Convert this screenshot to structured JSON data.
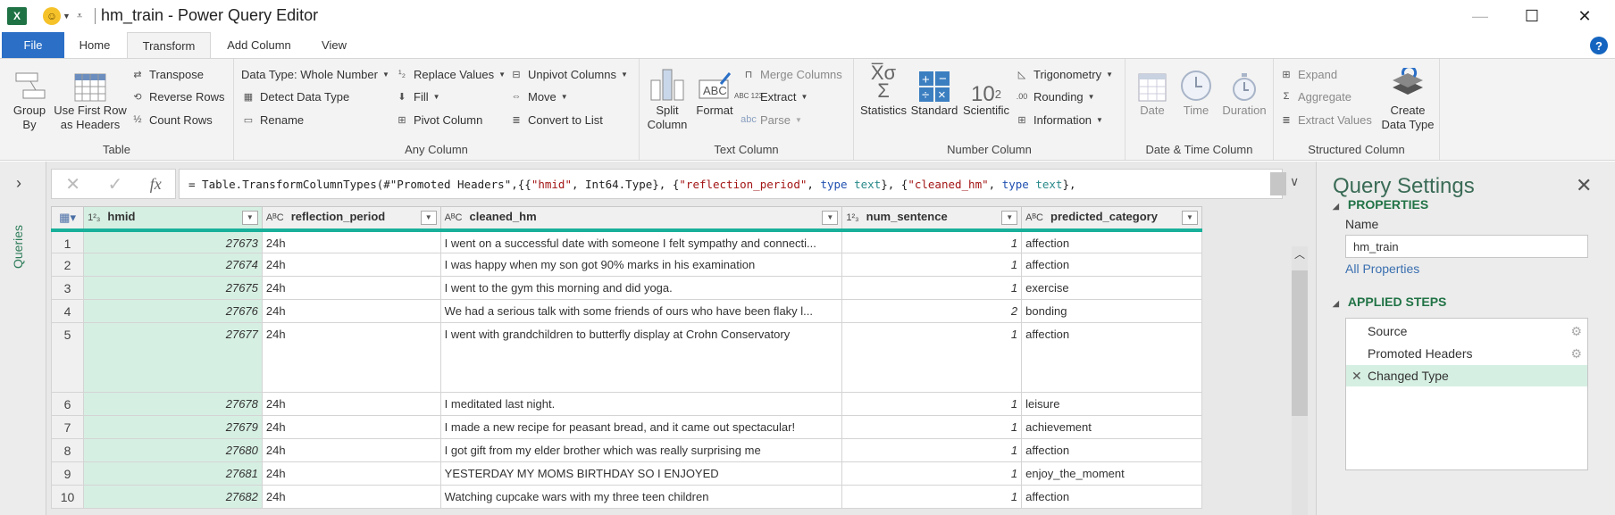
{
  "window": {
    "title": "hm_train - Power Query Editor",
    "app_icon": "excel-icon",
    "minimize": "—",
    "maximize": "☐",
    "close": "✕"
  },
  "tabs": [
    {
      "label": "File"
    },
    {
      "label": "Home"
    },
    {
      "label": "Transform",
      "active": true
    },
    {
      "label": "Add Column"
    },
    {
      "label": "View"
    }
  ],
  "ribbon": {
    "table": {
      "label": "Table",
      "group_by": "Group By",
      "use_first_row": "Use First Row as Headers",
      "transpose": "Transpose",
      "reverse_rows": "Reverse Rows",
      "count_rows": "Count Rows"
    },
    "any_column": {
      "label": "Any Column",
      "data_type": "Data Type: Whole Number",
      "detect_data_type": "Detect Data Type",
      "rename": "Rename",
      "replace_values": "Replace Values",
      "fill": "Fill",
      "pivot_column": "Pivot Column",
      "unpivot_columns": "Unpivot Columns",
      "move": "Move",
      "convert_to_list": "Convert to List"
    },
    "text_column": {
      "label": "Text Column",
      "split_column": "Split Column",
      "format": "Format",
      "merge_columns": "Merge Columns",
      "extract": "Extract",
      "parse": "Parse"
    },
    "number_column": {
      "label": "Number Column",
      "statistics": "Statistics",
      "standard": "Standard",
      "scientific": "Scientific",
      "trigonometry": "Trigonometry",
      "rounding": "Rounding",
      "information": "Information"
    },
    "datetime_column": {
      "label": "Date & Time Column",
      "date": "Date",
      "time": "Time",
      "duration": "Duration"
    },
    "structured_column": {
      "label": "Structured Column",
      "expand": "Expand",
      "aggregate": "Aggregate",
      "extract_values": "Extract Values",
      "create_data_type": "Create Data Type"
    }
  },
  "queries_pane": {
    "label": "Queries"
  },
  "formula_bar": {
    "prefix": "= Table.TransformColumnTypes(#\"Promoted Headers\",{{",
    "s1": "\"hmid\"",
    "p2": ", Int64.Type}, {",
    "s2": "\"reflection_period\"",
    "p3": ", ",
    "k1": "type",
    "t1": " text",
    "p4": "}, {",
    "s3": "\"cleaned_hm\"",
    "p5": ", ",
    "k2": "type",
    "t2": " text",
    "p6": "},"
  },
  "grid": {
    "columns": [
      {
        "type": "1²₃",
        "name": "hmid"
      },
      {
        "type": "A^B_C",
        "name": "reflection_period"
      },
      {
        "type": "A^B_C",
        "name": "cleaned_hm"
      },
      {
        "type": "1²₃",
        "name": "num_sentence"
      },
      {
        "type": "A^B_C",
        "name": "predicted_category"
      }
    ],
    "rows": [
      {
        "n": "1",
        "hmid": "27673",
        "period": "24h",
        "text": "I went on a successful date with someone I felt sympathy and connecti...",
        "num": "1",
        "cat": "affection"
      },
      {
        "n": "2",
        "hmid": "27674",
        "period": "24h",
        "text": "I was happy when my son got 90% marks in his examination",
        "num": "1",
        "cat": "affection"
      },
      {
        "n": "3",
        "hmid": "27675",
        "period": "24h",
        "text": "I went to the gym this morning and did yoga.",
        "num": "1",
        "cat": "exercise"
      },
      {
        "n": "4",
        "hmid": "27676",
        "period": "24h",
        "text": "We had a serious talk with some friends of ours who have been flaky l...",
        "num": "2",
        "cat": "bonding"
      },
      {
        "n": "5",
        "hmid": "27677",
        "period": "24h",
        "text": "I went with grandchildren to butterfly display at Crohn Conservatory",
        "num": "1",
        "cat": "affection"
      },
      {
        "n": "6",
        "hmid": "27678",
        "period": "24h",
        "text": "I meditated last night.",
        "num": "1",
        "cat": "leisure"
      },
      {
        "n": "7",
        "hmid": "27679",
        "period": "24h",
        "text": "I made a new recipe for peasant bread, and it came out spectacular!",
        "num": "1",
        "cat": "achievement"
      },
      {
        "n": "8",
        "hmid": "27680",
        "period": "24h",
        "text": "I got gift from my elder brother which was really surprising me",
        "num": "1",
        "cat": "affection"
      },
      {
        "n": "9",
        "hmid": "27681",
        "period": "24h",
        "text": "YESTERDAY MY MOMS BIRTHDAY SO I ENJOYED",
        "num": "1",
        "cat": "enjoy_the_moment"
      },
      {
        "n": "10",
        "hmid": "27682",
        "period": "24h",
        "text": "Watching cupcake wars with my three teen children",
        "num": "1",
        "cat": "affection"
      }
    ]
  },
  "query_settings": {
    "title": "Query Settings",
    "properties_header": "PROPERTIES",
    "name_label": "Name",
    "name_value": "hm_train",
    "all_properties": "All Properties",
    "applied_steps_header": "APPLIED STEPS",
    "steps": [
      {
        "label": "Source",
        "has_gear": true
      },
      {
        "label": "Promoted Headers",
        "has_gear": true
      },
      {
        "label": "Changed Type",
        "active": true
      }
    ]
  },
  "colors": {
    "accent_green": "#217346",
    "selected_column": "#d6efe3",
    "header_underline": "#18b09a",
    "file_tab": "#2b6fc6"
  }
}
